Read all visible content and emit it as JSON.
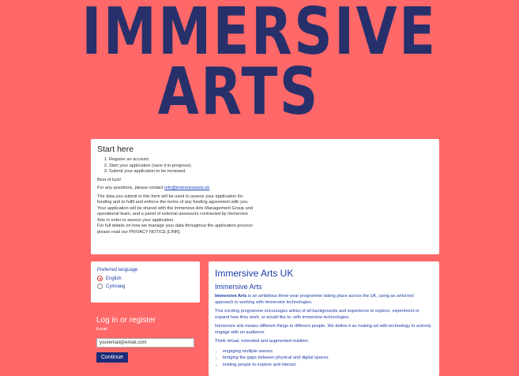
{
  "logo": {
    "line1": "IMMERSIVE",
    "line2": "ARTS"
  },
  "start_here": {
    "title": "Start here",
    "steps": [
      "Register an account.",
      "Start your application (save it in-progress).",
      "Submit your application to be reviewed."
    ],
    "luck": "Best of luck!",
    "contact_prefix": "For any questions, please contact ",
    "contact_email": "info@immersivearts.uk",
    "data_p1": "The data you submit in this form will be used to assess your application for funding and to fulfil and enforce the terms of any funding agreement with you.",
    "data_p2": "Your application will be shared with the Immersive Arts Management Group and operational team, and a panel of external assessors contracted by Immersive Arts in order to assess your application.",
    "data_p3": "For full details on how we manage your data throughout the application process please read our PRIVACY NOTICE [LINK]."
  },
  "language": {
    "title": "Preferred language",
    "options": [
      "English",
      "Cymraeg"
    ],
    "selected": "English"
  },
  "login": {
    "title": "Log in or register",
    "email_label": "Email",
    "email_value": "youremail@email.com",
    "continue_label": "Continue"
  },
  "info": {
    "title": "Immersive Arts UK",
    "subtitle": "Immersive Arts",
    "p1_bold": "Immersive Arts",
    "p1_rest": " is an ambitious three-year programme taking place across the UK, using an artist-led approach to working with immersive technologies.",
    "p2": "This exciting programme encourages artists of all backgrounds and experience to explore, experiment or expand how they work, or would like to, with immersive technologies.",
    "p3": "Immersive arts means different things to different people. We define it as making art with technology to actively engage with an audience.",
    "p4": "Think virtual, extended and augmented realities:",
    "bullets": [
      "engaging multiple senses",
      "bridging the gaps between physical and digital spaces",
      "inviting people to explore and interact"
    ]
  },
  "colors": {
    "background": "#ff6868",
    "brand": "#27306b",
    "link": "#1c3da7"
  }
}
